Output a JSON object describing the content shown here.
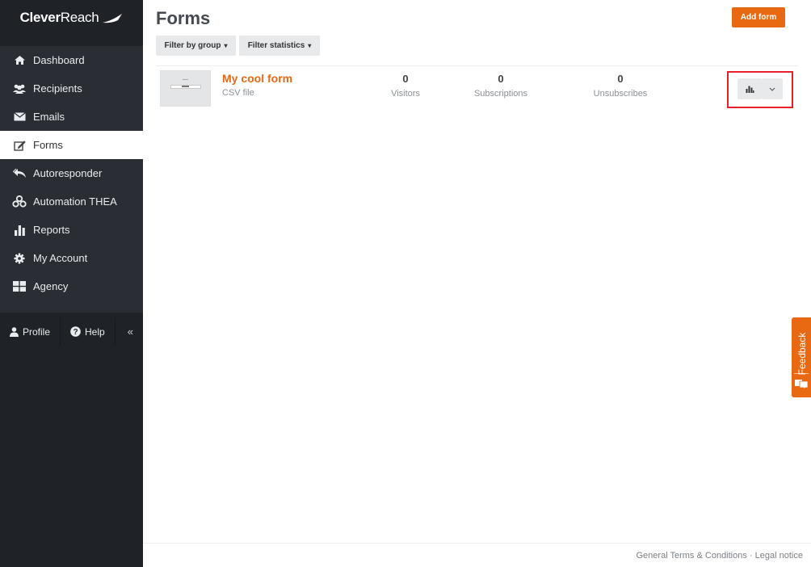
{
  "app": {
    "logo_bold": "Clever",
    "logo_thin": "Reach"
  },
  "sidebar": {
    "items": [
      {
        "label": "Dashboard",
        "icon": "home-icon"
      },
      {
        "label": "Recipients",
        "icon": "users-icon"
      },
      {
        "label": "Emails",
        "icon": "envelope-icon"
      },
      {
        "label": "Forms",
        "icon": "edit-icon",
        "active": true
      },
      {
        "label": "Autoresponder",
        "icon": "reply-all-icon"
      },
      {
        "label": "Automation THEA",
        "icon": "cubes-icon"
      },
      {
        "label": "Reports",
        "icon": "bar-chart-icon"
      },
      {
        "label": "My Account",
        "icon": "gear-icon"
      },
      {
        "label": "Agency",
        "icon": "grid-icon"
      }
    ],
    "profile_label": "Profile",
    "help_label": "Help",
    "collapse_label": "«"
  },
  "header": {
    "title": "Forms",
    "add_button": "Add form",
    "filter_group": "Filter by group",
    "filter_statistics": "Filter statistics"
  },
  "forms": [
    {
      "name": "My cool form",
      "type": "CSV file",
      "stats": [
        {
          "value": "0",
          "label": "Visitors"
        },
        {
          "value": "0",
          "label": "Subscriptions"
        },
        {
          "value": "0",
          "label": "Unsubscribes"
        }
      ]
    }
  ],
  "footer": {
    "terms": "General Terms & Conditions",
    "separator": "·",
    "legal": "Legal notice"
  },
  "feedback": {
    "label": "Feedback"
  },
  "colors": {
    "accent": "#e96912",
    "sidebar_bg": "#2a2d33",
    "highlight": "#e8202a"
  }
}
